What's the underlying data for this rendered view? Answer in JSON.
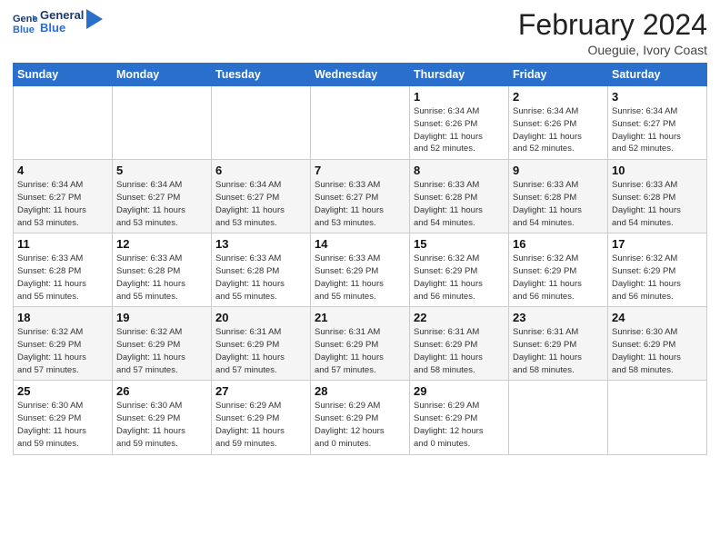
{
  "header": {
    "logo_line1": "General",
    "logo_line2": "Blue",
    "month_title": "February 2024",
    "location": "Oueguie, Ivory Coast"
  },
  "days_of_week": [
    "Sunday",
    "Monday",
    "Tuesday",
    "Wednesday",
    "Thursday",
    "Friday",
    "Saturday"
  ],
  "weeks": [
    [
      {
        "day": "",
        "info": ""
      },
      {
        "day": "",
        "info": ""
      },
      {
        "day": "",
        "info": ""
      },
      {
        "day": "",
        "info": ""
      },
      {
        "day": "1",
        "info": "Sunrise: 6:34 AM\nSunset: 6:26 PM\nDaylight: 11 hours\nand 52 minutes."
      },
      {
        "day": "2",
        "info": "Sunrise: 6:34 AM\nSunset: 6:26 PM\nDaylight: 11 hours\nand 52 minutes."
      },
      {
        "day": "3",
        "info": "Sunrise: 6:34 AM\nSunset: 6:27 PM\nDaylight: 11 hours\nand 52 minutes."
      }
    ],
    [
      {
        "day": "4",
        "info": "Sunrise: 6:34 AM\nSunset: 6:27 PM\nDaylight: 11 hours\nand 53 minutes."
      },
      {
        "day": "5",
        "info": "Sunrise: 6:34 AM\nSunset: 6:27 PM\nDaylight: 11 hours\nand 53 minutes."
      },
      {
        "day": "6",
        "info": "Sunrise: 6:34 AM\nSunset: 6:27 PM\nDaylight: 11 hours\nand 53 minutes."
      },
      {
        "day": "7",
        "info": "Sunrise: 6:33 AM\nSunset: 6:27 PM\nDaylight: 11 hours\nand 53 minutes."
      },
      {
        "day": "8",
        "info": "Sunrise: 6:33 AM\nSunset: 6:28 PM\nDaylight: 11 hours\nand 54 minutes."
      },
      {
        "day": "9",
        "info": "Sunrise: 6:33 AM\nSunset: 6:28 PM\nDaylight: 11 hours\nand 54 minutes."
      },
      {
        "day": "10",
        "info": "Sunrise: 6:33 AM\nSunset: 6:28 PM\nDaylight: 11 hours\nand 54 minutes."
      }
    ],
    [
      {
        "day": "11",
        "info": "Sunrise: 6:33 AM\nSunset: 6:28 PM\nDaylight: 11 hours\nand 55 minutes."
      },
      {
        "day": "12",
        "info": "Sunrise: 6:33 AM\nSunset: 6:28 PM\nDaylight: 11 hours\nand 55 minutes."
      },
      {
        "day": "13",
        "info": "Sunrise: 6:33 AM\nSunset: 6:28 PM\nDaylight: 11 hours\nand 55 minutes."
      },
      {
        "day": "14",
        "info": "Sunrise: 6:33 AM\nSunset: 6:29 PM\nDaylight: 11 hours\nand 55 minutes."
      },
      {
        "day": "15",
        "info": "Sunrise: 6:32 AM\nSunset: 6:29 PM\nDaylight: 11 hours\nand 56 minutes."
      },
      {
        "day": "16",
        "info": "Sunrise: 6:32 AM\nSunset: 6:29 PM\nDaylight: 11 hours\nand 56 minutes."
      },
      {
        "day": "17",
        "info": "Sunrise: 6:32 AM\nSunset: 6:29 PM\nDaylight: 11 hours\nand 56 minutes."
      }
    ],
    [
      {
        "day": "18",
        "info": "Sunrise: 6:32 AM\nSunset: 6:29 PM\nDaylight: 11 hours\nand 57 minutes."
      },
      {
        "day": "19",
        "info": "Sunrise: 6:32 AM\nSunset: 6:29 PM\nDaylight: 11 hours\nand 57 minutes."
      },
      {
        "day": "20",
        "info": "Sunrise: 6:31 AM\nSunset: 6:29 PM\nDaylight: 11 hours\nand 57 minutes."
      },
      {
        "day": "21",
        "info": "Sunrise: 6:31 AM\nSunset: 6:29 PM\nDaylight: 11 hours\nand 57 minutes."
      },
      {
        "day": "22",
        "info": "Sunrise: 6:31 AM\nSunset: 6:29 PM\nDaylight: 11 hours\nand 58 minutes."
      },
      {
        "day": "23",
        "info": "Sunrise: 6:31 AM\nSunset: 6:29 PM\nDaylight: 11 hours\nand 58 minutes."
      },
      {
        "day": "24",
        "info": "Sunrise: 6:30 AM\nSunset: 6:29 PM\nDaylight: 11 hours\nand 58 minutes."
      }
    ],
    [
      {
        "day": "25",
        "info": "Sunrise: 6:30 AM\nSunset: 6:29 PM\nDaylight: 11 hours\nand 59 minutes."
      },
      {
        "day": "26",
        "info": "Sunrise: 6:30 AM\nSunset: 6:29 PM\nDaylight: 11 hours\nand 59 minutes."
      },
      {
        "day": "27",
        "info": "Sunrise: 6:29 AM\nSunset: 6:29 PM\nDaylight: 11 hours\nand 59 minutes."
      },
      {
        "day": "28",
        "info": "Sunrise: 6:29 AM\nSunset: 6:29 PM\nDaylight: 12 hours\nand 0 minutes."
      },
      {
        "day": "29",
        "info": "Sunrise: 6:29 AM\nSunset: 6:29 PM\nDaylight: 12 hours\nand 0 minutes."
      },
      {
        "day": "",
        "info": ""
      },
      {
        "day": "",
        "info": ""
      }
    ]
  ]
}
